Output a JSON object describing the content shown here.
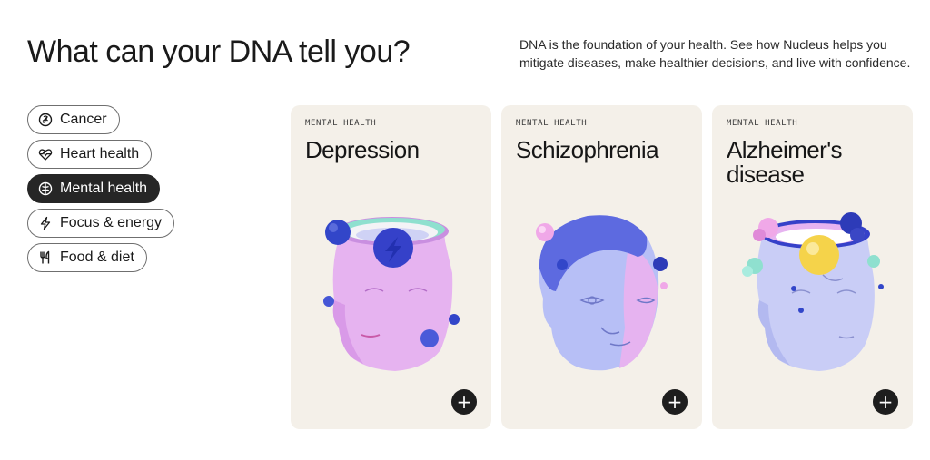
{
  "header": {
    "title": "What can your DNA tell you?",
    "description": "DNA is the foundation of your health. See how Nucleus helps you mitigate diseases, make healthier decisions, and live with confidence."
  },
  "filters": [
    {
      "label": "Cancer",
      "icon": "ribbon-icon",
      "selected": false
    },
    {
      "label": "Heart health",
      "icon": "heartbeat-icon",
      "selected": false
    },
    {
      "label": "Mental health",
      "icon": "brain-icon",
      "selected": true
    },
    {
      "label": "Focus & energy",
      "icon": "lightning-icon",
      "selected": false
    },
    {
      "label": "Food & diet",
      "icon": "fork-knife-icon",
      "selected": false
    }
  ],
  "cards": [
    {
      "category": "MENTAL HEALTH",
      "title": "Depression",
      "icon": "plus-icon"
    },
    {
      "category": "MENTAL HEALTH",
      "title": "Schizophrenia",
      "icon": "plus-icon"
    },
    {
      "category": "MENTAL HEALTH",
      "title": "Alzheimer's disease",
      "icon": "plus-icon"
    }
  ],
  "colors": {
    "card_bg": "#f4f0e9",
    "active_pill": "#262626",
    "accent_blue": "#2f3fc8",
    "accent_pink": "#e9b4ef",
    "accent_lavender": "#b7bff6"
  }
}
